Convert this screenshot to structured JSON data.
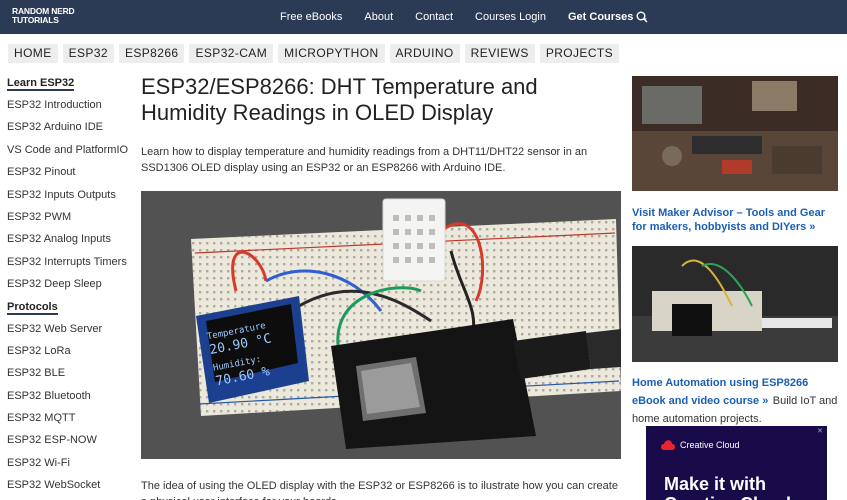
{
  "header": {
    "logo_line1": "RANDOM NERD",
    "logo_line2": "TUTORIALS",
    "nav": [
      {
        "label": "Free eBooks"
      },
      {
        "label": "About"
      },
      {
        "label": "Contact"
      },
      {
        "label": "Courses Login"
      },
      {
        "label": "Get Courses"
      }
    ]
  },
  "categories": [
    "HOME",
    "ESP32",
    "ESP8266",
    "ESP32-CAM",
    "MICROPYTHON",
    "ARDUINO",
    "REVIEWS",
    "PROJECTS"
  ],
  "sidebar": {
    "learn_heading": "Learn ESP32",
    "learn_items": [
      "ESP32 Introduction",
      "ESP32 Arduino IDE",
      "VS Code and PlatformIO",
      "ESP32 Pinout",
      "ESP32 Inputs Outputs",
      "ESP32 PWM",
      "ESP32 Analog Inputs",
      "ESP32 Interrupts Timers",
      "ESP32 Deep Sleep"
    ],
    "protocols_heading": "Protocols",
    "protocol_items": [
      "ESP32 Web Server",
      "ESP32 LoRa",
      "ESP32 BLE",
      "ESP32 Bluetooth",
      "ESP32 MQTT",
      "ESP32 ESP-NOW",
      "ESP32 Wi-Fi",
      "ESP32 WebSocket"
    ]
  },
  "article": {
    "title": "ESP32/ESP8266: DHT Temperature and Humidity Readings in OLED Display",
    "intro": "Learn how to display temperature and humidity readings from a DHT11/DHT22 sensor in an SSD1306 OLED display using an ESP32 or an ESP8266 with Arduino IDE.",
    "oled_line1": "Temperature",
    "oled_temp": "20.90 °C",
    "oled_line2": "Humidity:",
    "oled_hum": "70.60 %",
    "after_text": "The idea of using the OLED display with the ESP32 or ESP8266 is to ilustrate how you can create a physical user interface for your boards."
  },
  "right": {
    "ad1_link": "Visit Maker Advisor – Tools and Gear for makers, hobbyists and DIYers »",
    "ad2_link": "Home Automation using ESP8266 eBook and video course »",
    "ad2_text": "Build IoT and home automation projects.",
    "banner_brand": "Creative Cloud",
    "banner_headline": "Make it with Creative Cloud"
  },
  "colors": {
    "nav_bg": "#2b3a55",
    "link": "#1a5fb4"
  }
}
